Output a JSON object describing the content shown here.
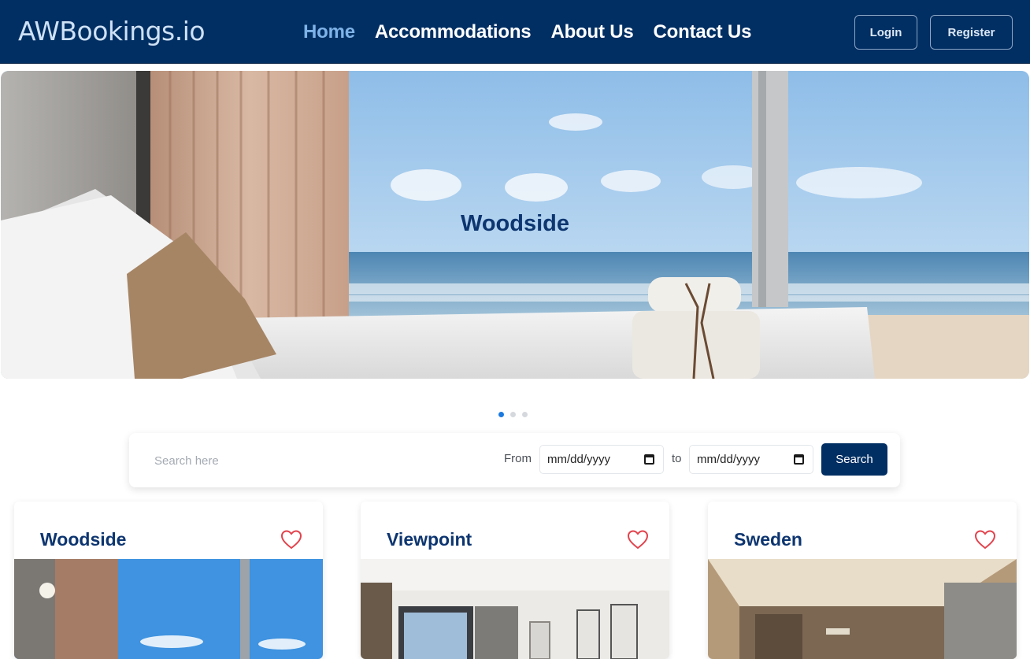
{
  "navbar": {
    "brand": "AWBookings.io",
    "links": [
      {
        "label": "Home",
        "active": true
      },
      {
        "label": "Accommodations",
        "active": false
      },
      {
        "label": "About Us",
        "active": false
      },
      {
        "label": "Contact Us",
        "active": false
      }
    ],
    "login_label": "Login",
    "register_label": "Register"
  },
  "hero": {
    "title": "Woodside",
    "slide_count": 3,
    "active_slide": 1
  },
  "search": {
    "placeholder": "Search here",
    "from_label": "From",
    "to_label": "to",
    "date_from_value": "mm/dd/yyyy",
    "date_to_value": "mm/dd/yyyy",
    "button_label": "Search"
  },
  "cards": [
    {
      "title": "Woodside"
    },
    {
      "title": "Viewpoint"
    },
    {
      "title": "Sweden"
    }
  ],
  "colors": {
    "nav_bg": "#012f63",
    "accent_active": "#7fb3e8",
    "title_blue": "#0d3570",
    "heart": "#e2424c",
    "dot_active": "#1b7ae0"
  },
  "icons": [
    "heart-icon",
    "calendar-icon"
  ]
}
